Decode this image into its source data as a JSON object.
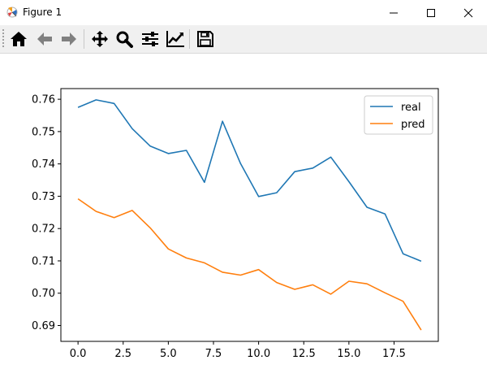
{
  "window": {
    "title": "Figure 1"
  },
  "toolbar": {
    "tools": [
      {
        "name": "home-icon"
      },
      {
        "name": "back-arrow-icon"
      },
      {
        "name": "forward-arrow-icon"
      },
      {
        "name": "pan-icon"
      },
      {
        "name": "zoom-icon"
      },
      {
        "name": "subplots-config-icon"
      },
      {
        "name": "edit-axis-icon"
      },
      {
        "name": "save-icon"
      }
    ]
  },
  "chart_data": {
    "type": "line",
    "x": [
      0,
      1,
      2,
      3,
      4,
      5,
      6,
      7,
      8,
      9,
      10,
      11,
      12,
      13,
      14,
      15,
      16,
      17,
      18,
      19
    ],
    "series": [
      {
        "name": "real",
        "color": "#1f77b4",
        "values": [
          0.7575,
          0.7598,
          0.7587,
          0.7509,
          0.7455,
          0.7432,
          0.7442,
          0.7343,
          0.7532,
          0.7401,
          0.7299,
          0.7311,
          0.7376,
          0.7387,
          0.7421,
          0.7345,
          0.7266,
          0.7245,
          0.7122,
          0.7099
        ]
      },
      {
        "name": "pred",
        "color": "#ff7f0e",
        "values": [
          0.7292,
          0.7253,
          0.7234,
          0.7256,
          0.7202,
          0.7137,
          0.7109,
          0.7094,
          0.7065,
          0.7056,
          0.7073,
          0.7033,
          0.7012,
          0.7026,
          0.6997,
          0.7037,
          0.7029,
          0.7001,
          0.6975,
          0.6886
        ]
      }
    ],
    "xlim": [
      -0.95,
      19.95
    ],
    "ylim": [
      0.6851,
      0.7633
    ],
    "xticks": [
      0,
      2.5,
      5,
      7.5,
      10,
      12.5,
      15,
      17.5
    ],
    "xtick_labels": [
      "0.0",
      "2.5",
      "5.0",
      "7.5",
      "10.0",
      "12.5",
      "15.0",
      "17.5"
    ],
    "yticks": [
      0.69,
      0.7,
      0.71,
      0.72,
      0.73,
      0.74,
      0.75,
      0.76
    ],
    "ytick_labels": [
      "0.69",
      "0.70",
      "0.71",
      "0.72",
      "0.73",
      "0.74",
      "0.75",
      "0.76"
    ],
    "legend": "top-right",
    "grid": false
  }
}
